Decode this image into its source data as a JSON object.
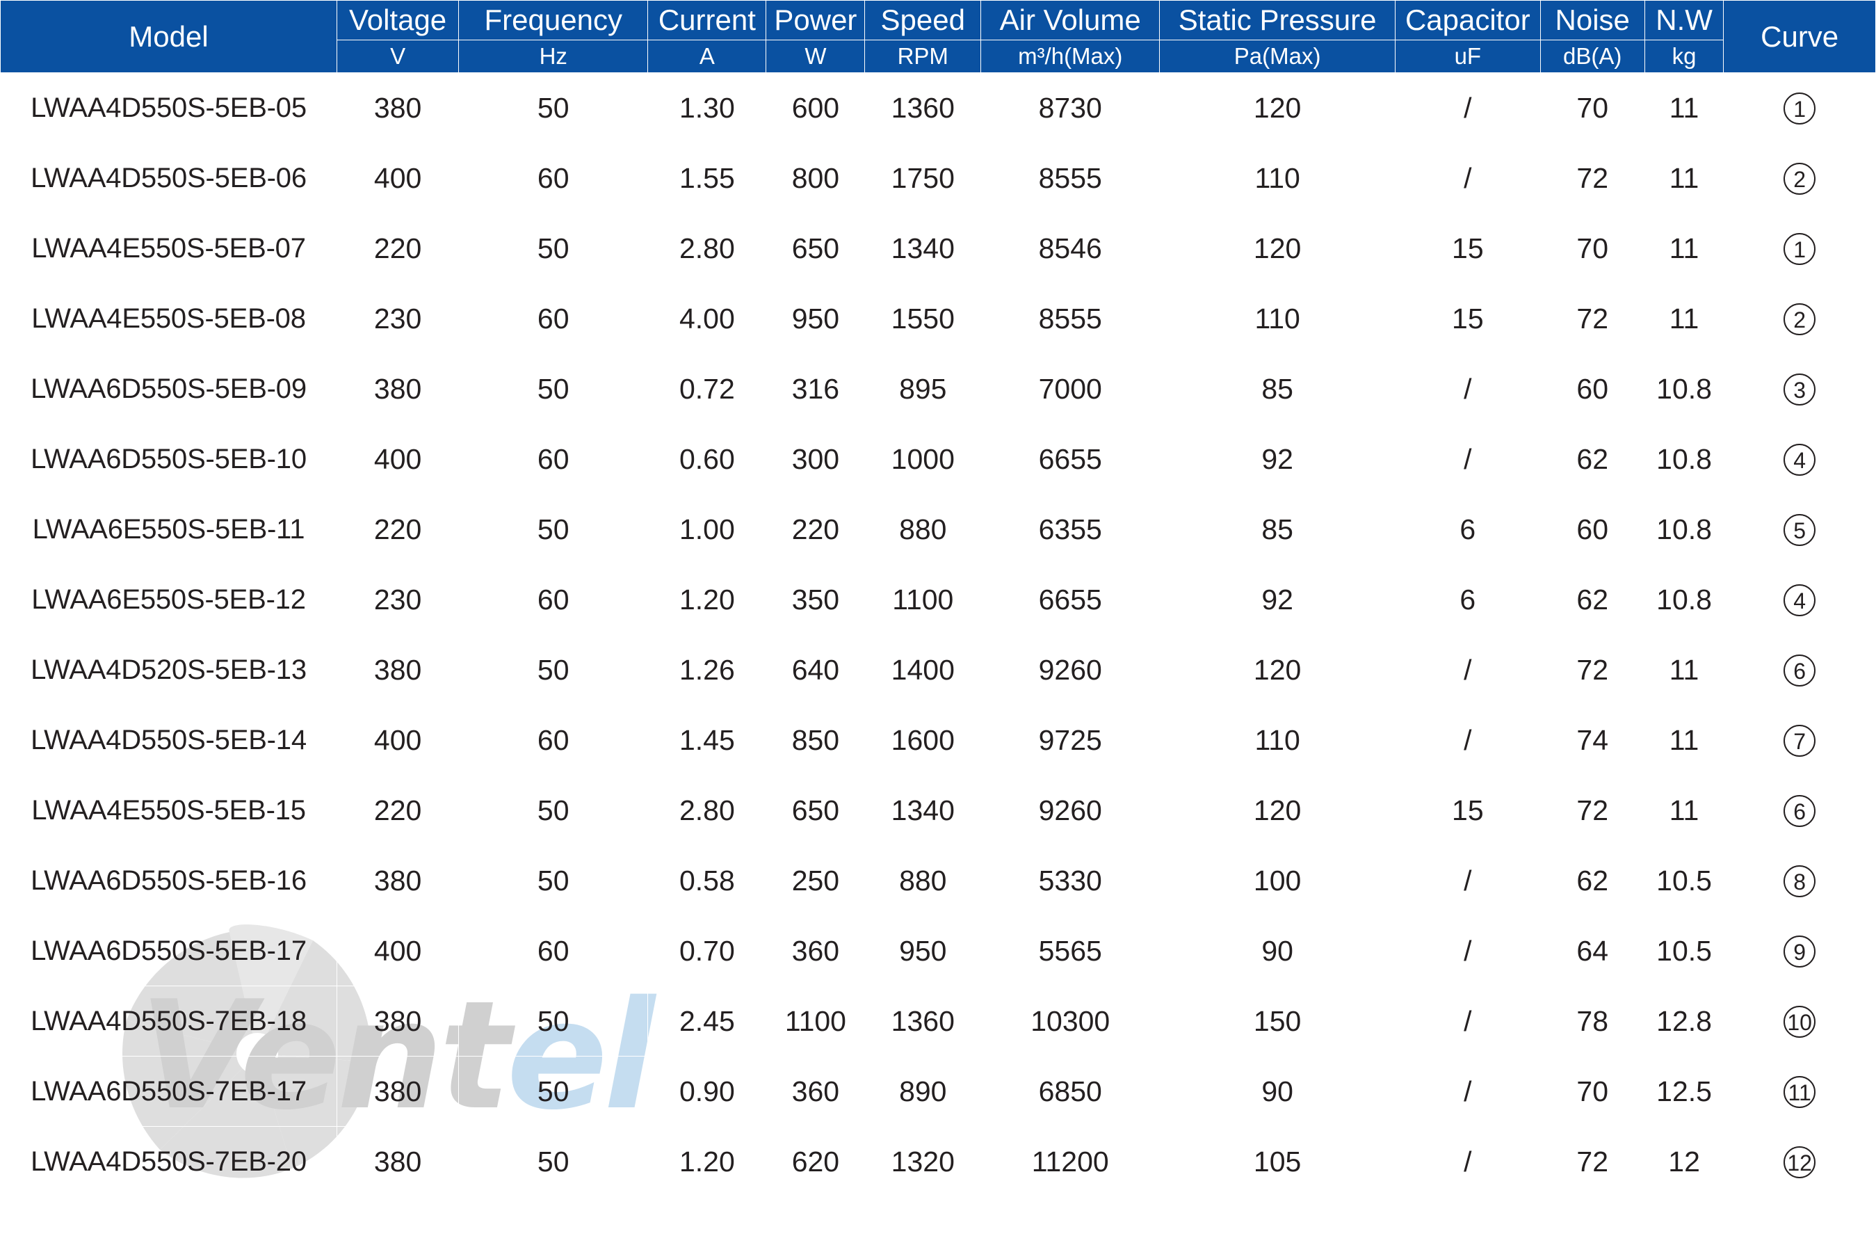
{
  "watermark": {
    "text_part1": "Vent",
    "text_part2": "el",
    "logo_name": "fan-blade-logo"
  },
  "table": {
    "headers": [
      {
        "key": "model",
        "label": "Model",
        "unit": ""
      },
      {
        "key": "voltage",
        "label": "Voltage",
        "unit": "V"
      },
      {
        "key": "freq",
        "label": "Frequency",
        "unit": "Hz"
      },
      {
        "key": "current",
        "label": "Current",
        "unit": "A"
      },
      {
        "key": "power",
        "label": "Power",
        "unit": "W"
      },
      {
        "key": "speed",
        "label": "Speed",
        "unit": "RPM"
      },
      {
        "key": "airvol",
        "label": "Air Volume",
        "unit": "m³/h(Max)"
      },
      {
        "key": "static",
        "label": "Static Pressure",
        "unit": "Pa(Max)"
      },
      {
        "key": "cap",
        "label": "Capacitor",
        "unit": "uF"
      },
      {
        "key": "noise",
        "label": "Noise",
        "unit": "dB(A)"
      },
      {
        "key": "nw",
        "label": "N.W",
        "unit": "kg"
      },
      {
        "key": "curve",
        "label": "Curve",
        "unit": ""
      }
    ],
    "rows": [
      {
        "model": "LWAA4D550S-5EB-05",
        "voltage": "380",
        "freq": "50",
        "current": "1.30",
        "power": "600",
        "speed": "1360",
        "airvol": "8730",
        "static": "120",
        "cap": "/",
        "noise": "70",
        "nw": "11",
        "curve": "1"
      },
      {
        "model": "LWAA4D550S-5EB-06",
        "voltage": "400",
        "freq": "60",
        "current": "1.55",
        "power": "800",
        "speed": "1750",
        "airvol": "8555",
        "static": "110",
        "cap": "/",
        "noise": "72",
        "nw": "11",
        "curve": "2"
      },
      {
        "model": "LWAA4E550S-5EB-07",
        "voltage": "220",
        "freq": "50",
        "current": "2.80",
        "power": "650",
        "speed": "1340",
        "airvol": "8546",
        "static": "120",
        "cap": "15",
        "noise": "70",
        "nw": "11",
        "curve": "1"
      },
      {
        "model": "LWAA4E550S-5EB-08",
        "voltage": "230",
        "freq": "60",
        "current": "4.00",
        "power": "950",
        "speed": "1550",
        "airvol": "8555",
        "static": "110",
        "cap": "15",
        "noise": "72",
        "nw": "11",
        "curve": "2"
      },
      {
        "model": "LWAA6D550S-5EB-09",
        "voltage": "380",
        "freq": "50",
        "current": "0.72",
        "power": "316",
        "speed": "895",
        "airvol": "7000",
        "static": "85",
        "cap": "/",
        "noise": "60",
        "nw": "10.8",
        "curve": "3"
      },
      {
        "model": "LWAA6D550S-5EB-10",
        "voltage": "400",
        "freq": "60",
        "current": "0.60",
        "power": "300",
        "speed": "1000",
        "airvol": "6655",
        "static": "92",
        "cap": "/",
        "noise": "62",
        "nw": "10.8",
        "curve": "4"
      },
      {
        "model": "LWAA6E550S-5EB-11",
        "voltage": "220",
        "freq": "50",
        "current": "1.00",
        "power": "220",
        "speed": "880",
        "airvol": "6355",
        "static": "85",
        "cap": "6",
        "noise": "60",
        "nw": "10.8",
        "curve": "5"
      },
      {
        "model": "LWAA6E550S-5EB-12",
        "voltage": "230",
        "freq": "60",
        "current": "1.20",
        "power": "350",
        "speed": "1100",
        "airvol": "6655",
        "static": "92",
        "cap": "6",
        "noise": "62",
        "nw": "10.8",
        "curve": "4"
      },
      {
        "model": "LWAA4D520S-5EB-13",
        "voltage": "380",
        "freq": "50",
        "current": "1.26",
        "power": "640",
        "speed": "1400",
        "airvol": "9260",
        "static": "120",
        "cap": "/",
        "noise": "72",
        "nw": "11",
        "curve": "6"
      },
      {
        "model": "LWAA4D550S-5EB-14",
        "voltage": "400",
        "freq": "60",
        "current": "1.45",
        "power": "850",
        "speed": "1600",
        "airvol": "9725",
        "static": "110",
        "cap": "/",
        "noise": "74",
        "nw": "11",
        "curve": "7"
      },
      {
        "model": "LWAA4E550S-5EB-15",
        "voltage": "220",
        "freq": "50",
        "current": "2.80",
        "power": "650",
        "speed": "1340",
        "airvol": "9260",
        "static": "120",
        "cap": "15",
        "noise": "72",
        "nw": "11",
        "curve": "6"
      },
      {
        "model": "LWAA6D550S-5EB-16",
        "voltage": "380",
        "freq": "50",
        "current": "0.58",
        "power": "250",
        "speed": "880",
        "airvol": "5330",
        "static": "100",
        "cap": "/",
        "noise": "62",
        "nw": "10.5",
        "curve": "8"
      },
      {
        "model": "LWAA6D550S-5EB-17",
        "voltage": "400",
        "freq": "60",
        "current": "0.70",
        "power": "360",
        "speed": "950",
        "airvol": "5565",
        "static": "90",
        "cap": "/",
        "noise": "64",
        "nw": "10.5",
        "curve": "9"
      },
      {
        "model": "LWAA4D550S-7EB-18",
        "voltage": "380",
        "freq": "50",
        "current": "2.45",
        "power": "1100",
        "speed": "1360",
        "airvol": "10300",
        "static": "150",
        "cap": "/",
        "noise": "78",
        "nw": "12.8",
        "curve": "10"
      },
      {
        "model": "LWAA6D550S-7EB-17",
        "voltage": "380",
        "freq": "50",
        "current": "0.90",
        "power": "360",
        "speed": "890",
        "airvol": "6850",
        "static": "90",
        "cap": "/",
        "noise": "70",
        "nw": "12.5",
        "curve": "11"
      },
      {
        "model": "LWAA4D550S-7EB-20",
        "voltage": "380",
        "freq": "50",
        "current": "1.20",
        "power": "620",
        "speed": "1320",
        "airvol": "11200",
        "static": "105",
        "cap": "/",
        "noise": "72",
        "nw": "12",
        "curve": "12"
      }
    ]
  },
  "colors": {
    "header_blue": "#0a51a1",
    "grid_gray": "#9d9d9d",
    "text_dark": "#231f20",
    "watermark_gray": "#c8c8c8",
    "watermark_blue": "#bcd8ee"
  }
}
